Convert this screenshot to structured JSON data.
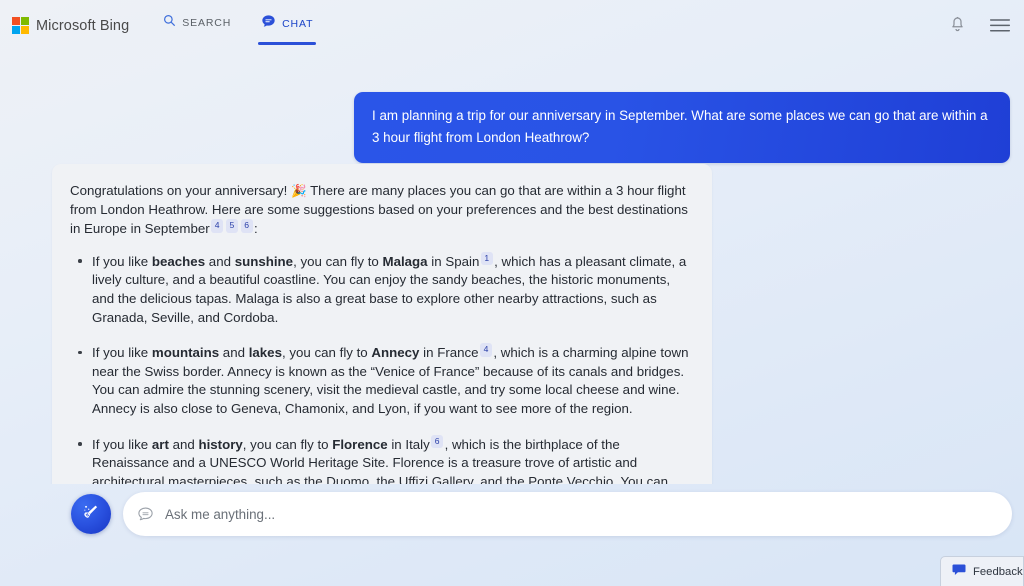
{
  "header": {
    "brand_name": "Microsoft Bing",
    "logo_icon": "microsoft-logo-icon",
    "logo_colors": [
      "#f25022",
      "#7fba00",
      "#00a4ef",
      "#ffb900"
    ],
    "tabs": [
      {
        "label": "SEARCH",
        "icon": "search-icon",
        "active": false
      },
      {
        "label": "CHAT",
        "icon": "chat-bubble-icon",
        "active": true
      }
    ],
    "right_icons": [
      {
        "name": "notification-bell-icon"
      },
      {
        "name": "hamburger-menu-icon"
      }
    ],
    "accent_color": "#2b50d8"
  },
  "conversation": {
    "user_message": "I am planning a trip for our anniversary in September. What are some places we can go that are within a 3 hour flight from London Heathrow?",
    "user_bubble_color": "#2a55e8",
    "bot_response": {
      "intro_part1": "Congratulations on your anniversary!",
      "intro_emoji": "🎉",
      "intro_part2": "There are many places you can go that are within a 3 hour flight from London Heathrow. Here are some suggestions based on your preferences and the best destinations in Europe in September",
      "intro_citations": [
        "4",
        "5",
        "6"
      ],
      "intro_suffix": ":",
      "bullets": [
        {
          "lead": "If you like ",
          "bold1": "beaches",
          "mid1": " and ",
          "bold2": "sunshine",
          "mid2": ", you can fly to ",
          "bold3": "Malaga",
          "mid3": " in Spain",
          "citation": "1",
          "tail": ", which has a pleasant climate, a lively culture, and a beautiful coastline. You can enjoy the sandy beaches, the historic monuments, and the delicious tapas. Malaga is also a great base to explore other nearby attractions, such as Granada, Seville, and Cordoba."
        },
        {
          "lead": "If you like ",
          "bold1": "mountains",
          "mid1": " and ",
          "bold2": "lakes",
          "mid2": ", you can fly to ",
          "bold3": "Annecy",
          "mid3": " in France",
          "citation": "4",
          "tail": ", which is a charming alpine town near the Swiss border. Annecy is known as the “Venice of France” because of its canals and bridges. You can admire the stunning scenery, visit the medieval castle, and try some local cheese and wine. Annecy is also close to Geneva, Chamonix, and Lyon, if you want to see more of the region."
        },
        {
          "lead": "If you like ",
          "bold1": "art",
          "mid1": " and ",
          "bold2": "history",
          "mid2": ", you can fly to ",
          "bold3": "Florence",
          "mid3": " in Italy",
          "citation": "6",
          "tail": ", which is the birthplace of the Renaissance and a UNESCO World Heritage Site. Florence is a treasure trove of artistic and architectural masterpieces, such as the Duomo, the Uffizi Gallery, and the Ponte Vecchio. You can also explore the Tuscan countryside, taste the famous gelato, and shop for leather goods."
        }
      ]
    }
  },
  "composer": {
    "new_topic_icon": "broom-sweep-icon",
    "input_icon": "chat-bubble-icon",
    "input_value": "",
    "placeholder": "Ask me anything..."
  },
  "feedback": {
    "label": "Feedback",
    "icon": "feedback-bubble-icon"
  }
}
